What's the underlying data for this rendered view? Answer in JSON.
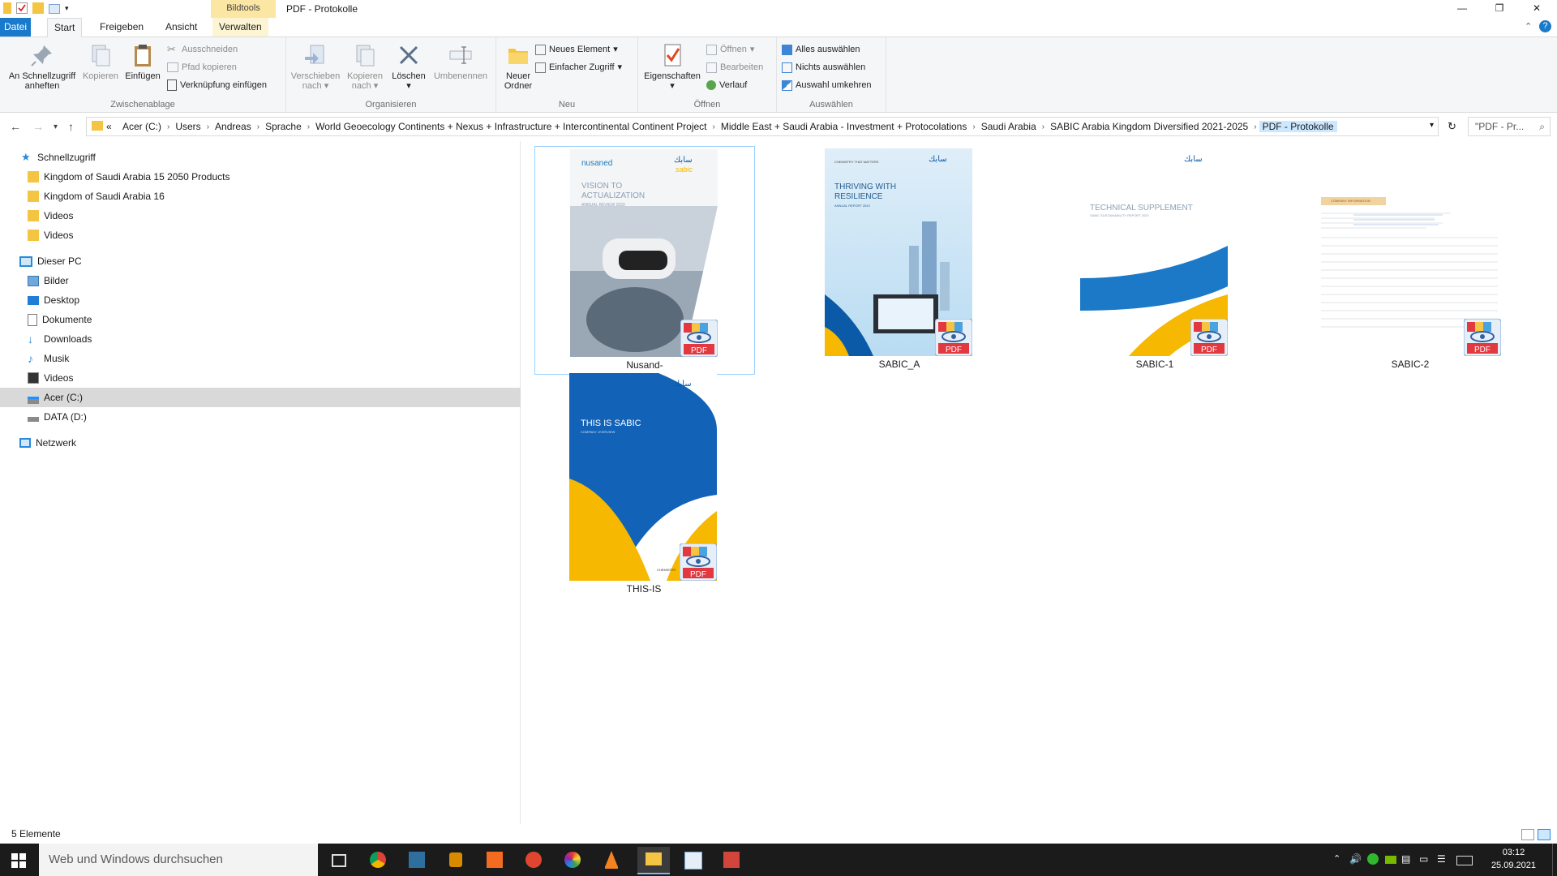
{
  "window": {
    "title": "PDF - Protokolle",
    "contextual_tab_group": "Bildtools"
  },
  "tabs": [
    {
      "label": "Datei"
    },
    {
      "label": "Start"
    },
    {
      "label": "Freigeben"
    },
    {
      "label": "Ansicht"
    },
    {
      "label": "Verwalten"
    }
  ],
  "ribbon": {
    "zwischenablage": {
      "label": "Zwischenablage",
      "pin": "An Schnellzugriff\nanheften",
      "pin_l1": "An Schnellzugriff",
      "pin_l2": "anheften",
      "copy": "Kopieren",
      "paste": "Einfügen",
      "cut": "Ausschneiden",
      "copy_path": "Pfad kopieren",
      "paste_shortcut": "Verknüpfung einfügen"
    },
    "organisieren": {
      "label": "Organisieren",
      "move_l1": "Verschieben",
      "move_l2": "nach",
      "copyto_l1": "Kopieren",
      "copyto_l2": "nach",
      "delete": "Löschen",
      "rename": "Umbenennen"
    },
    "neu": {
      "label": "Neu",
      "new_folder_l1": "Neuer",
      "new_folder_l2": "Ordner",
      "new_item": "Neues Element",
      "easy_access": "Einfacher Zugriff"
    },
    "oeffnen": {
      "label": "Öffnen",
      "properties": "Eigenschaften",
      "open": "Öffnen",
      "edit": "Bearbeiten",
      "history": "Verlauf"
    },
    "auswaehlen": {
      "label": "Auswählen",
      "select_all": "Alles auswählen",
      "select_none": "Nichts auswählen",
      "invert": "Auswahl umkehren"
    }
  },
  "address": {
    "prefix": "«",
    "crumbs": [
      "Acer (C:)",
      "Users",
      "Andreas",
      "Sprache",
      "World Geoecology Continents + Nexus + Infrastructure + Intercontinental Continent Project",
      "Middle East + Saudi Arabia - Investment + Protocolations",
      "Saudi Arabia",
      "SABIC Arabia Kingdom Diversified 2021-2025",
      "PDF - Protokolle"
    ],
    "search_placeholder": "\"PDF - Pr..."
  },
  "sidebar": {
    "quick_access": "Schnellzugriff",
    "quick_items": [
      "Kingdom of Saudi Arabia 15 2050 Products",
      "Kingdom of Saudi Arabia 16",
      "Videos",
      "Videos"
    ],
    "this_pc": "Dieser PC",
    "pc_items": [
      "Bilder",
      "Desktop",
      "Dokumente",
      "Downloads",
      "Musik",
      "Videos",
      "Acer (C:)",
      "DATA (D:)"
    ],
    "network": "Netzwerk"
  },
  "files": [
    {
      "name": "Nusand-",
      "cover_brand": "nusaned",
      "cover_brand_sub": "sabic",
      "cover_title": "VISION TO\nACTUALIZATION",
      "cover_title_l1": "VISION TO",
      "cover_title_l2": "ACTUALIZATION",
      "cover_sub": "ANNUAL REVIEW 2020"
    },
    {
      "name": "SABIC_A",
      "cover_tag": "CHEMISTRY THAT MATTERS",
      "cover_title_l1": "THRIVING WITH",
      "cover_title_l2": "RESILIENCE",
      "cover_sub": "ANNUAL REPORT 2020"
    },
    {
      "name": "SABIC-1",
      "cover_title_l1": "TECHNICAL SUPPLEMENT",
      "cover_sub": "SABIC SUSTAINABILITY REPORT 2020"
    },
    {
      "name": "SABIC-2",
      "cover_tag": "COMPANY INFORMATION"
    },
    {
      "name": "THIS-IS",
      "cover_title_l1": "THIS IS SABIC",
      "cover_sub": "COMPANY OVERVIEW",
      "cover_foot": "CHEMISTRY"
    }
  ],
  "pdf_badge": "PDF",
  "status": {
    "count": "5 Elemente"
  },
  "taskbar": {
    "search_placeholder": "Web und Windows durchsuchen",
    "time": "03:12",
    "date": "25.09.2021"
  },
  "colors": {
    "accent": "#1979ca",
    "selection": "#cce8ff",
    "sabic_blue": "#0a5aa8",
    "sabic_yellow": "#f6b800"
  }
}
